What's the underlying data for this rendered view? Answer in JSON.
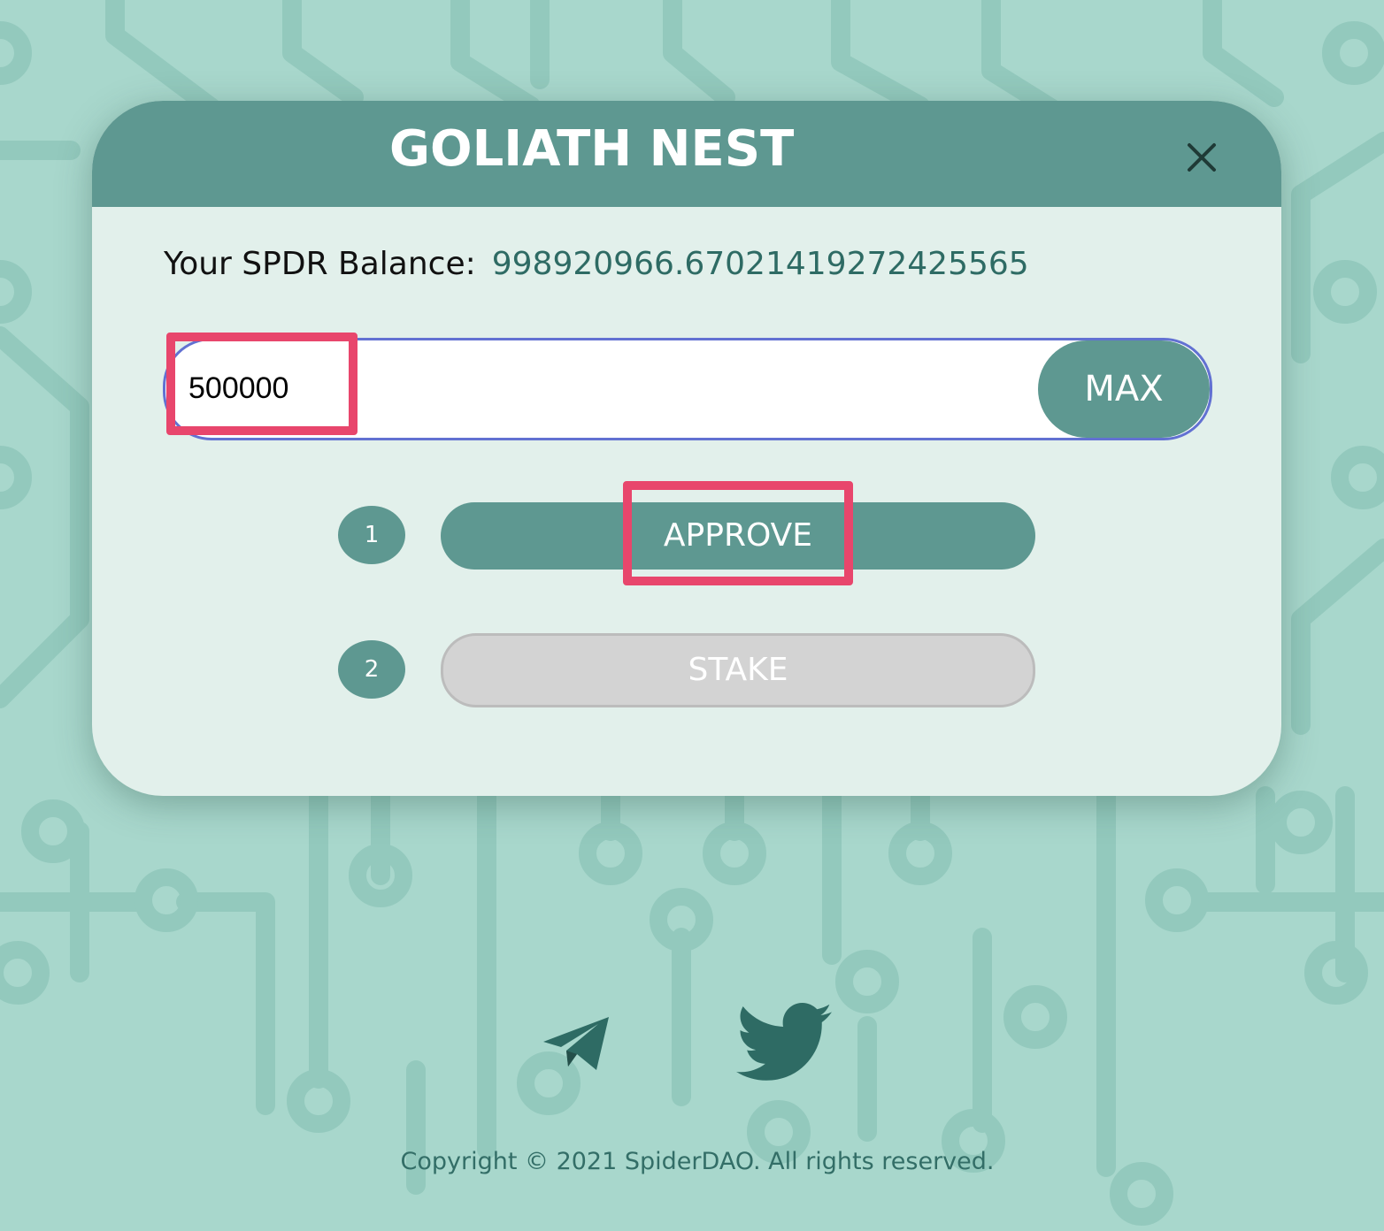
{
  "modal": {
    "title": "GOLIATH NEST",
    "close_icon": "close-icon",
    "balance_label": "Your SPDR Balance:",
    "balance_value": "998920966.67021419272425565",
    "amount_input_value": "500000",
    "max_label": "MAX",
    "steps": [
      {
        "number": "1",
        "label": "APPROVE",
        "enabled": true
      },
      {
        "number": "2",
        "label": "STAKE",
        "enabled": false
      }
    ]
  },
  "footer": {
    "social_icons": [
      "telegram-icon",
      "twitter-icon"
    ],
    "copyright": "Copyright © 2021 SpiderDAO. All rights reserved."
  },
  "colors": {
    "background": "#a8d7cc",
    "primary": "#5e9891",
    "panel": "#e2f0eb",
    "highlight": "#e8466c",
    "input_border": "#6271d2",
    "disabled": "#d3d3d3",
    "balance_text": "#2e6b64",
    "footer_text": "#336e67"
  }
}
